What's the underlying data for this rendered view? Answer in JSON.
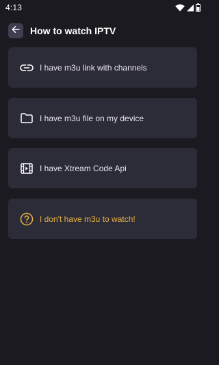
{
  "status_bar": {
    "time": "4:13"
  },
  "header": {
    "title": "How to watch IPTV",
    "back_icon": "arrow-left-icon"
  },
  "options": [
    {
      "label": "I have m3u link with channels",
      "icon": "link-icon"
    },
    {
      "label": "I have m3u file on my device",
      "icon": "folder-icon"
    },
    {
      "label": "I have Xtream Code Api",
      "icon": "video-film-icon"
    },
    {
      "label": "I don't have m3u to watch!",
      "icon": "question-circle-icon",
      "color": "#e7b446"
    }
  ],
  "colors": {
    "background": "#1b1a21",
    "card": "#2c2b38",
    "accent": "#e7b446"
  }
}
